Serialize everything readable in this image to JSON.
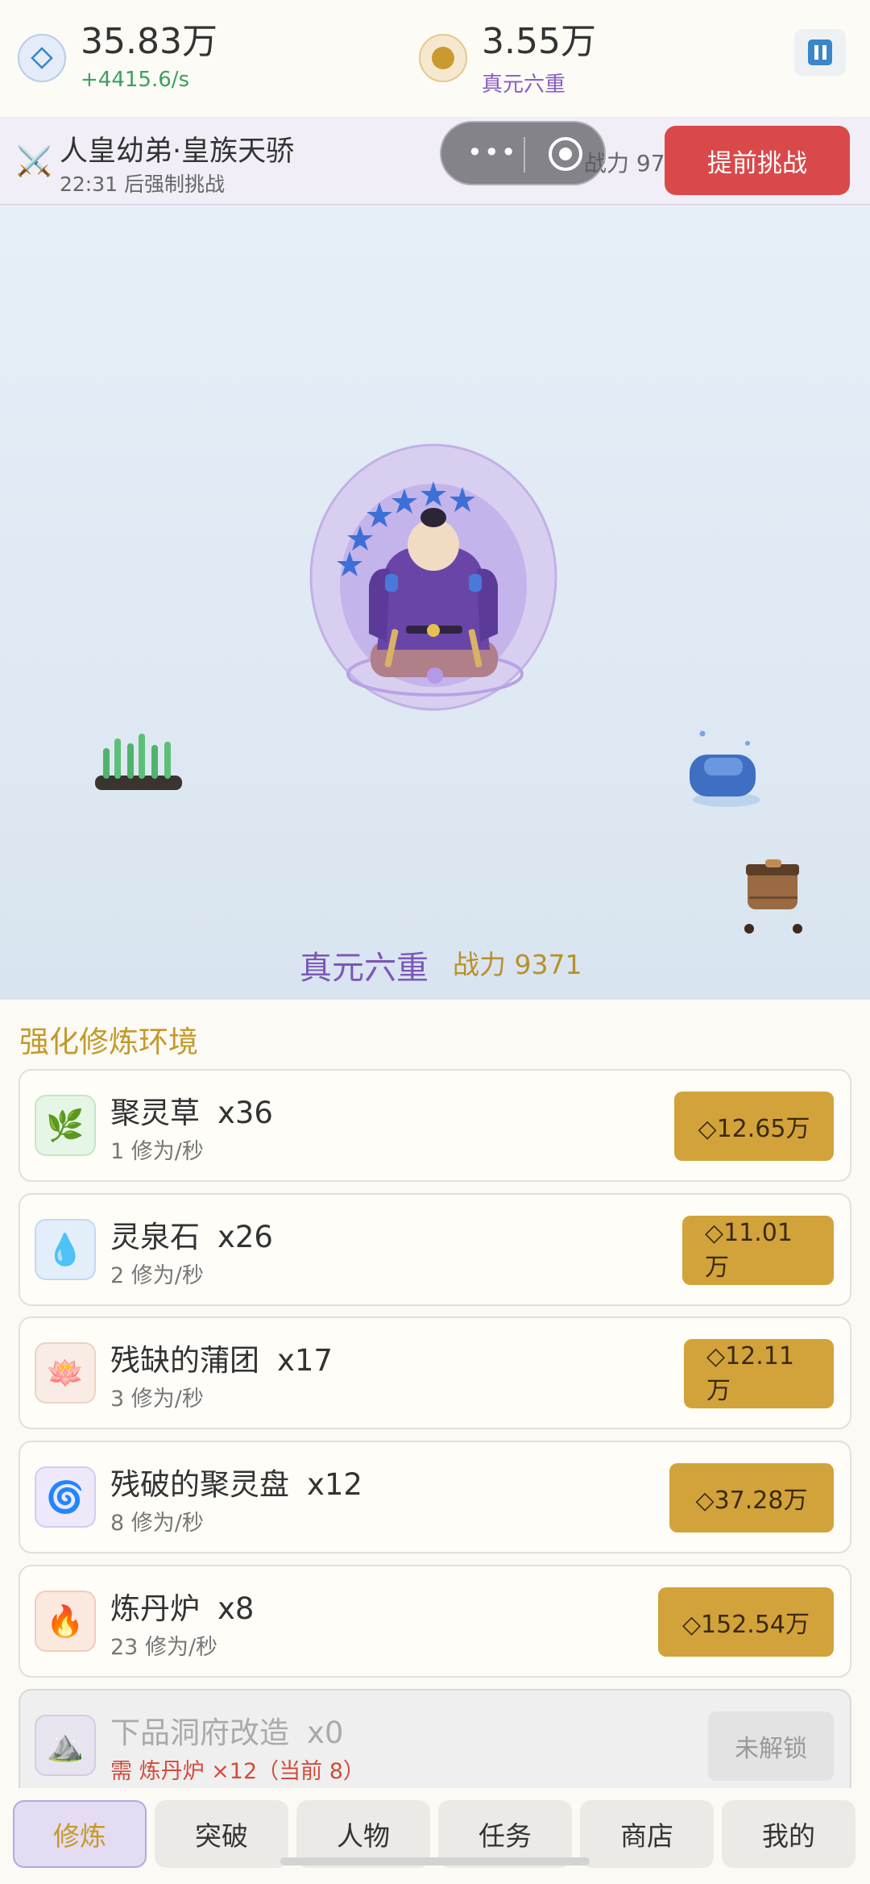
{
  "top": {
    "gem_value": "35.83万",
    "gem_rate": "+4415.6/s",
    "coin_value": "3.55万",
    "coin_sub": "真元六重",
    "gem_icon": "gem-icon",
    "coin_icon": "coin-icon"
  },
  "banner": {
    "title": "人皇幼弟·皇族天骄",
    "timer": "22:31 后强制挑战",
    "power": "战力 9775",
    "challenge": "提前挑战"
  },
  "scene": {
    "realm": "真元六重",
    "power": "战力 9371"
  },
  "section_title": "强化修炼环境",
  "items": [
    {
      "name": "聚灵草",
      "count": "x36",
      "rate": "1 修为/秒",
      "price": "◇12.65万",
      "icon": "herb-icon"
    },
    {
      "name": "灵泉石",
      "count": "x26",
      "rate": "2 修为/秒",
      "price": "◇11.01万",
      "icon": "water-drop-icon"
    },
    {
      "name": "残缺的蒲团",
      "count": "x17",
      "rate": "3 修为/秒",
      "price": "◇12.11万",
      "icon": "lotus-icon"
    },
    {
      "name": "残破的聚灵盘",
      "count": "x12",
      "rate": "8 修为/秒",
      "price": "◇37.28万",
      "icon": "swirl-icon"
    },
    {
      "name": "炼丹炉",
      "count": "x8",
      "rate": "23 修为/秒",
      "price": "◇152.54万",
      "icon": "fire-icon"
    },
    {
      "name": "下品洞府改造",
      "count": "x0",
      "rate": "需 炼丹炉 ×12（当前 8）",
      "price": "未解锁",
      "icon": "mountain-icon"
    }
  ],
  "tabs": [
    "修炼",
    "突破",
    "人物",
    "任务",
    "商店",
    "我的"
  ],
  "colors": {
    "accent_gold": "#d2a33a",
    "accent_purple": "#7b57b8",
    "challenge_red": "#d9494a"
  }
}
